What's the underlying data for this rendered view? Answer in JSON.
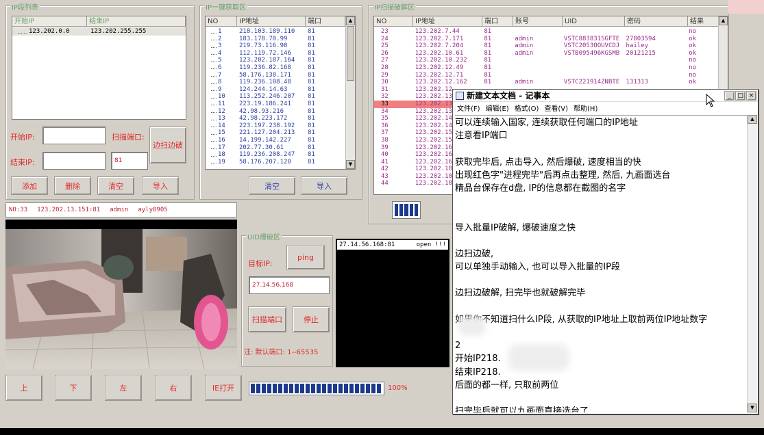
{
  "ip_list": {
    "title": "IP段列表",
    "col_start": "开始IP",
    "col_end": "结束IP",
    "row": {
      "start": "123.202.0.0",
      "end": "123.202.255.255"
    },
    "start_ip_label": "开始IP:",
    "end_ip_label": "结束IP:",
    "scan_port_label": "扫描端口:",
    "port_value": "81",
    "edge_button": "边扫边破",
    "buttons": [
      "添加",
      "删除",
      "清空",
      "导入"
    ]
  },
  "oneclick": {
    "title": "IP一键获取区",
    "col_no": "NO",
    "col_ip": "IP地址",
    "col_port": "端口",
    "rows": [
      [
        "1",
        "218.103.189.110",
        "81"
      ],
      [
        "2",
        "183.178.70.99",
        "81"
      ],
      [
        "3",
        "219.73.116.90",
        "81"
      ],
      [
        "4",
        "112.119.72.146",
        "81"
      ],
      [
        "5",
        "123.202.187.164",
        "81"
      ],
      [
        "6",
        "119.236.82.168",
        "81"
      ],
      [
        "7",
        "58.176.138.171",
        "81"
      ],
      [
        "8",
        "119.236.108.48",
        "81"
      ],
      [
        "9",
        "124.244.14.63",
        "81"
      ],
      [
        "10",
        "113.252.246.207",
        "81"
      ],
      [
        "11",
        "223.19.186.241",
        "81"
      ],
      [
        "12",
        "42.98.93.216",
        "81"
      ],
      [
        "13",
        "42.98.223.172",
        "81"
      ],
      [
        "14",
        "223.197.238.192",
        "81"
      ],
      [
        "15",
        "221.127.204.213",
        "81"
      ],
      [
        "16",
        "14.199.142.227",
        "81"
      ],
      [
        "17",
        "202.77.30.61",
        "81"
      ],
      [
        "18",
        "119.236.208.247",
        "81"
      ],
      [
        "19",
        "58.176.207.120",
        "81"
      ]
    ],
    "buttons": [
      "清空",
      "导入"
    ]
  },
  "crack": {
    "title": "IP扫描破解区",
    "cols": [
      "NO",
      "IP地址",
      "端口",
      "账号",
      "UID",
      "密码",
      "结果"
    ],
    "rows": [
      [
        "23",
        "123.202.7.44",
        "81",
        "",
        "",
        "",
        "no"
      ],
      [
        "24",
        "123.202.7.171",
        "81",
        "admin",
        "VSTC883831SGFTE",
        "27803594",
        "ok"
      ],
      [
        "25",
        "123.202.7.204",
        "81",
        "admin",
        "VSTC2053OOUVCDJ",
        "hailey",
        "ok"
      ],
      [
        "26",
        "123.202.10.61",
        "81",
        "admin",
        "VSTB095496KGSMB",
        "20121215",
        "ok"
      ],
      [
        "27",
        "123.202.10.232",
        "81",
        "",
        "",
        "",
        "no"
      ],
      [
        "28",
        "123.202.12.49",
        "81",
        "",
        "",
        "",
        "no"
      ],
      [
        "29",
        "123.202.12.71",
        "81",
        "",
        "",
        "",
        "no"
      ],
      [
        "30",
        "123.202.12.162",
        "81",
        "admin",
        "VSTC221914ZNBTE",
        "131313",
        "ok"
      ],
      [
        "31",
        "123.202.12",
        "",
        "",
        "",
        "",
        ""
      ],
      [
        "32",
        "123.202.13",
        "",
        "",
        "",
        "",
        ""
      ],
      [
        "33",
        "123.202.13",
        "",
        "",
        "",
        "",
        ""
      ],
      [
        "34",
        "123.202.13",
        "",
        "",
        "",
        "",
        ""
      ],
      [
        "35",
        "123.202.14",
        "",
        "",
        "",
        "",
        ""
      ],
      [
        "36",
        "123.202.14",
        "",
        "",
        "",
        "",
        ""
      ],
      [
        "37",
        "123.202.15",
        "",
        "",
        "",
        "",
        ""
      ],
      [
        "38",
        "123.202.15",
        "",
        "",
        "",
        "",
        ""
      ],
      [
        "39",
        "123.202.16",
        "",
        "",
        "",
        "",
        ""
      ],
      [
        "40",
        "123.202.16",
        "",
        "",
        "",
        "",
        ""
      ],
      [
        "41",
        "123.202.16",
        "",
        "",
        "",
        "",
        ""
      ],
      [
        "42",
        "123.202.18",
        "",
        "",
        "",
        "",
        ""
      ],
      [
        "43",
        "123.202.18",
        "",
        "",
        "",
        "",
        ""
      ],
      [
        "44",
        "123.202.18",
        "",
        "",
        "",
        "",
        ""
      ]
    ],
    "selected_index": 10
  },
  "status_line": {
    "no": "NO:33",
    "ip": "123.202.13.151:81",
    "user": "admin",
    "pass": "ayly0905"
  },
  "uid": {
    "title": "UID爆破区",
    "target_label": "目标IP:",
    "ping": "ping",
    "target_value": "27.14.56.168",
    "scan_port": "扫描端口",
    "stop": "停止",
    "note": "注: 默认端口: 1--65535",
    "console_ip": "27.14.56.168:81",
    "console_status": "open !!!"
  },
  "direction_buttons": [
    "上",
    "下",
    "左",
    "右",
    "IE打开"
  ],
  "progress": {
    "label": "100%",
    "value": 1.0
  },
  "notepad": {
    "title": "新建文本文档 - 记事本",
    "menu": [
      "文件(F)",
      "编辑(E)",
      "格式(O)",
      "查看(V)",
      "帮助(H)"
    ],
    "lines": [
      "可以连续输入国家, 连续获取任何端口的IP地址",
      "注意看IP端口",
      "",
      "获取完毕后, 点击导入, 然后爆破, 速度相当的快",
      "出现红色字\"进程完毕\"后再点击整理, 然后, 九画面选台",
      "精品台保存在d盘, IP的信息都在截图的名字",
      "",
      "",
      "导入批量IP破解, 爆破速度之快",
      "",
      "边扫边破,",
      "可以单独手动输入, 也可以导入批量的IP段",
      "",
      "边扫边破解, 扫完毕也就破解完毕",
      "",
      "如果你不知道扫什么IP段, 从获取的IP地址上取前两位IP地址数字",
      "",
      "2",
      "开始IP218.",
      "结束IP218.",
      "后面的都一样, 只取前两位",
      "",
      "扫完毕后就可以九画面直接选台了"
    ]
  }
}
